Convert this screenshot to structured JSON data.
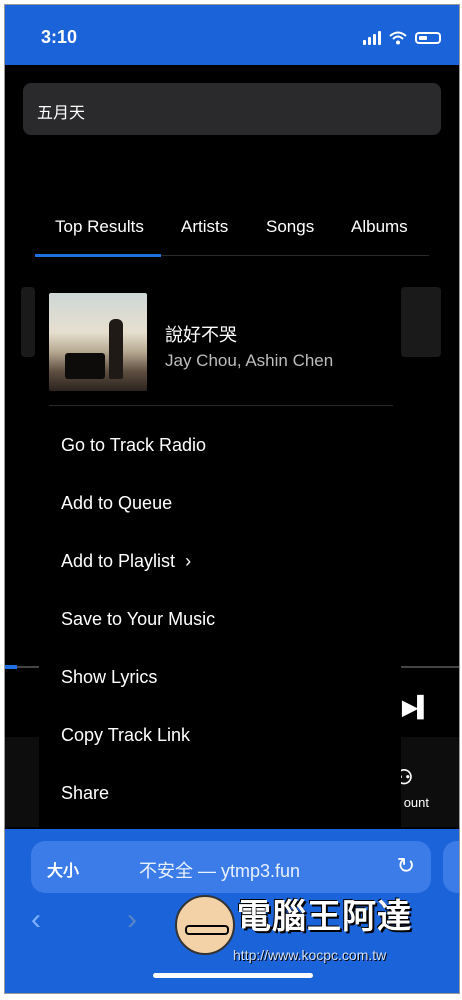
{
  "status": {
    "time": "3:10"
  },
  "search": {
    "value": "五月天"
  },
  "tabs": [
    {
      "label": "Top Results",
      "active": true
    },
    {
      "label": "Artists"
    },
    {
      "label": "Songs"
    },
    {
      "label": "Albums"
    }
  ],
  "track": {
    "title": "說好不哭",
    "artist": "Jay Chou, Ashin Chen"
  },
  "menu": {
    "items": [
      "Go to Track Radio",
      "Add to Queue",
      "Add to Playlist",
      "Save to Your Music",
      "Show Lyrics",
      "Copy Track Link",
      "Share"
    ]
  },
  "player": {
    "count_label": "ount"
  },
  "browser": {
    "text_size_label": "大小",
    "url_text": "不安全 — ytmp3.fun"
  },
  "watermark": {
    "title": "電腦王阿達",
    "url": "http://www.kocpc.com.tw"
  },
  "colors": {
    "accent": "#1e6fe0",
    "bar": "#1a63d8"
  },
  "icons": [
    "signal-icon",
    "wifi-icon",
    "battery-icon",
    "chevron-right-icon",
    "next-track-icon",
    "reload-icon",
    "back-icon",
    "forward-icon"
  ]
}
